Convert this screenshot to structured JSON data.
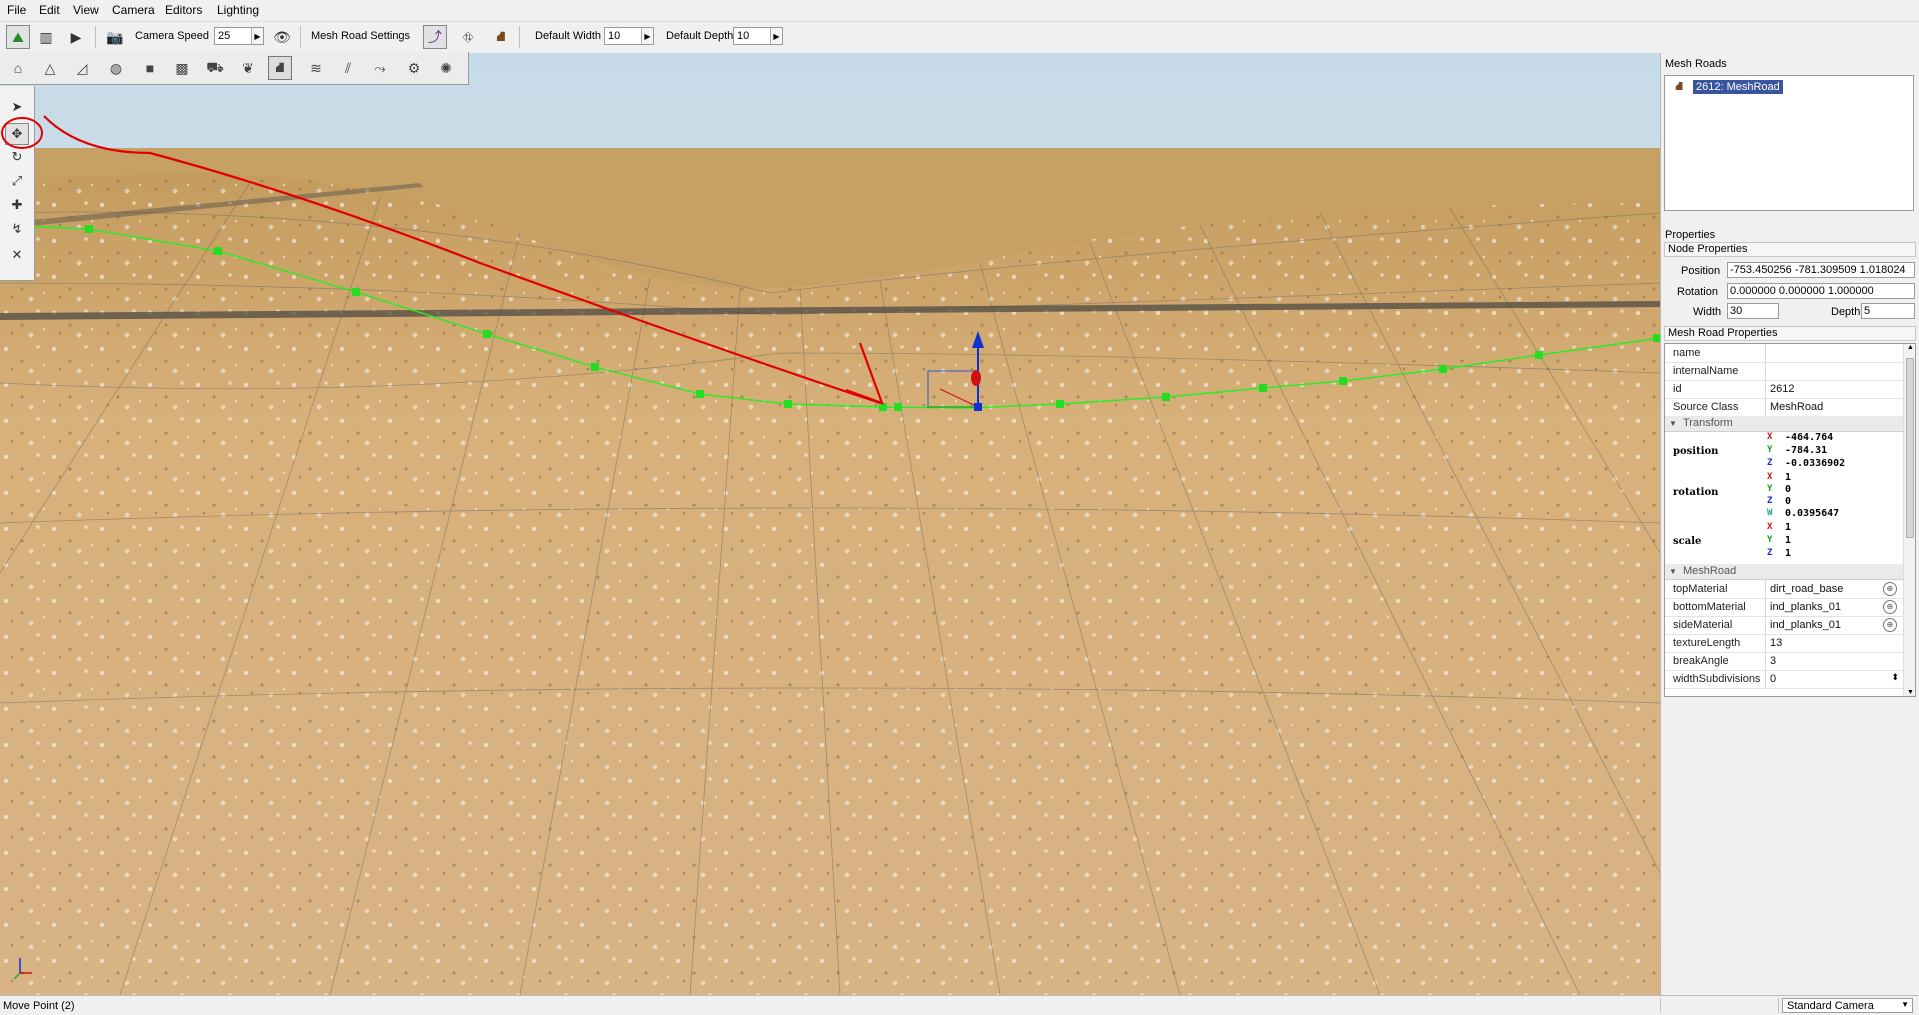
{
  "menu": [
    "File",
    "Edit",
    "View",
    "Camera",
    "Editors",
    "Lighting"
  ],
  "toolbar": {
    "camera_speed_label": "Camera Speed",
    "camera_speed_value": "25",
    "mesh_road_settings_label": "Mesh Road Settings",
    "default_width_label": "Default Width",
    "default_width_value": "10",
    "default_depth_label": "Default Depth",
    "default_depth_value": "10"
  },
  "palette_icons": [
    "terrain-icon",
    "terrain-sculpt-icon",
    "terrain-paint-icon",
    "world-icon",
    "object-icon",
    "material-icon",
    "decal-icon",
    "forest-icon",
    "river-icon",
    "mesh-road-icon",
    "road-icon",
    "path-icon",
    "navmesh-icon",
    "particle-icon"
  ],
  "tool_icons": [
    "select-icon",
    "move-point-icon",
    "rotate-icon",
    "scale-icon",
    "create-point-icon",
    "insert-point-icon",
    "remove-point-icon"
  ],
  "right_panel": {
    "mesh_roads_title": "Mesh Roads",
    "tree_item": "2612: MeshRoad",
    "properties_title": "Properties",
    "node_properties_title": "Node Properties",
    "position_label": "Position",
    "position_value": "-753.450256 -781.309509 1.018024",
    "rotation_label": "Rotation",
    "rotation_value": "0.000000 0.000000 1.000000",
    "width_label": "Width",
    "width_value": "30",
    "depth_label": "Depth",
    "depth_value": "5",
    "mesh_road_properties_title": "Mesh Road Properties"
  },
  "inspector": {
    "fields": [
      {
        "key": "name",
        "value": ""
      },
      {
        "key": "internalName",
        "value": ""
      },
      {
        "key": "id",
        "value": "2612"
      },
      {
        "key": "Source Class",
        "value": "MeshRoad"
      }
    ],
    "transform_group": "Transform",
    "position_key": "position",
    "position": [
      {
        "axis": "X",
        "value": "-464.764"
      },
      {
        "axis": "Y",
        "value": "-784.31"
      },
      {
        "axis": "Z",
        "value": "-0.0336902"
      }
    ],
    "rotation_key": "rotation",
    "rotation": [
      {
        "axis": "X",
        "value": "1"
      },
      {
        "axis": "Y",
        "value": "0"
      },
      {
        "axis": "Z",
        "value": "0"
      },
      {
        "axis": "W",
        "value": "0.0395647"
      }
    ],
    "scale_key": "scale",
    "scale": [
      {
        "axis": "X",
        "value": "1"
      },
      {
        "axis": "Y",
        "value": "1"
      },
      {
        "axis": "Z",
        "value": "1"
      }
    ],
    "meshroad_group": "MeshRoad",
    "meshroad_fields": [
      {
        "key": "topMaterial",
        "value": "dirt_road_base"
      },
      {
        "key": "bottomMaterial",
        "value": "ind_planks_01"
      },
      {
        "key": "sideMaterial",
        "value": "ind_planks_01"
      },
      {
        "key": "textureLength",
        "value": "13"
      },
      {
        "key": "breakAngle",
        "value": "3"
      },
      {
        "key": "widthSubdivisions",
        "value": "0"
      }
    ]
  },
  "status": {
    "left_text": "Move Point (2)",
    "camera_mode": "Standard Camera"
  },
  "colors": {
    "axis_x": "#d01010",
    "axis_y": "#10a010",
    "axis_z": "#1030d0",
    "selection": "#3a55a0",
    "road_spline": "#22ee22",
    "annotation": "#e00000"
  }
}
